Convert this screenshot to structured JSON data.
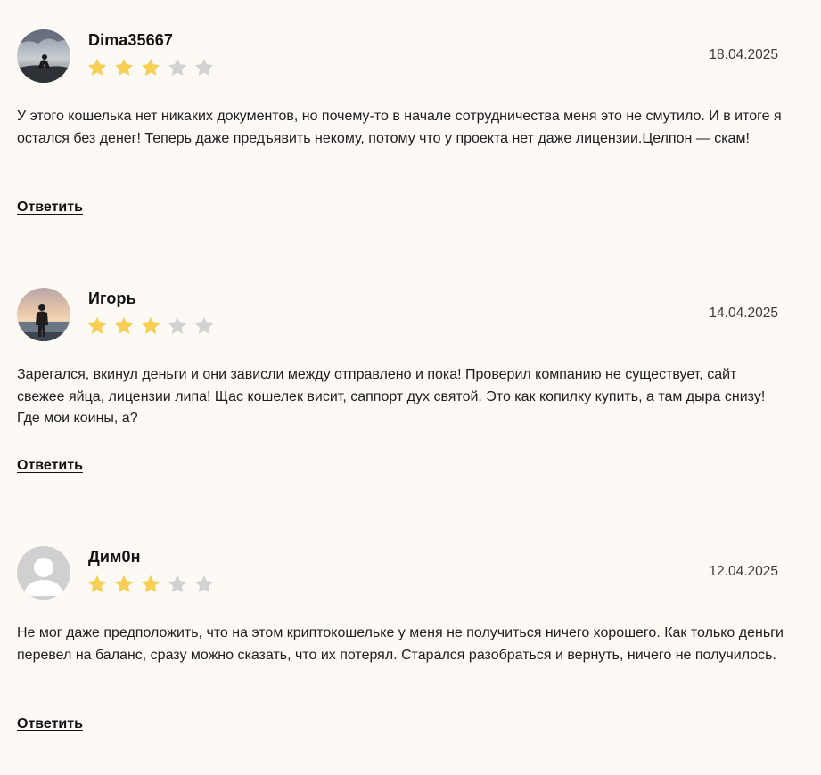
{
  "colors": {
    "background": "#fdfaf6",
    "star_filled": "#f7cf55",
    "star_empty": "#d2d2d2"
  },
  "star_icon": "star-icon",
  "reviews": [
    {
      "author": "Dima35667",
      "rating": 3,
      "max_rating": 5,
      "date": "18.04.2025",
      "text": "У этого кошелька нет никаких документов, но почему-то в начале сотрудничества меня это не смутило. И в итоге я остался без денег! Теперь даже предъявить некому, потому что у проекта нет даже лицензии.Целпон — скам!",
      "reply_label": "Ответить",
      "avatar": "photo-avatar-sitting-person"
    },
    {
      "author": "Игорь",
      "rating": 3,
      "max_rating": 5,
      "date": "14.04.2025",
      "text": "Зарегался, вкинул деньги и они зависли между отправлено и пока! Проверил компанию не существует, сайт свежее яйца, лицензии липа! Щас кошелек висит, саппорт дух святой. Это как копилку купить, а там дыра снизу! Где мои коины, а?",
      "reply_label": "Ответить",
      "avatar": "photo-avatar-sunset-person"
    },
    {
      "author": "Дим0н",
      "rating": 3,
      "max_rating": 5,
      "date": "12.04.2025",
      "text": "Не мог даже предположить, что на этом криптокошельке у меня не получиться ничего хорошего. Как только деньги перевел на баланс, сразу можно сказать, что их потерял. Старался разобраться и вернуть, ничего не получилось.",
      "reply_label": "Ответить",
      "avatar": "default-user-avatar"
    }
  ]
}
